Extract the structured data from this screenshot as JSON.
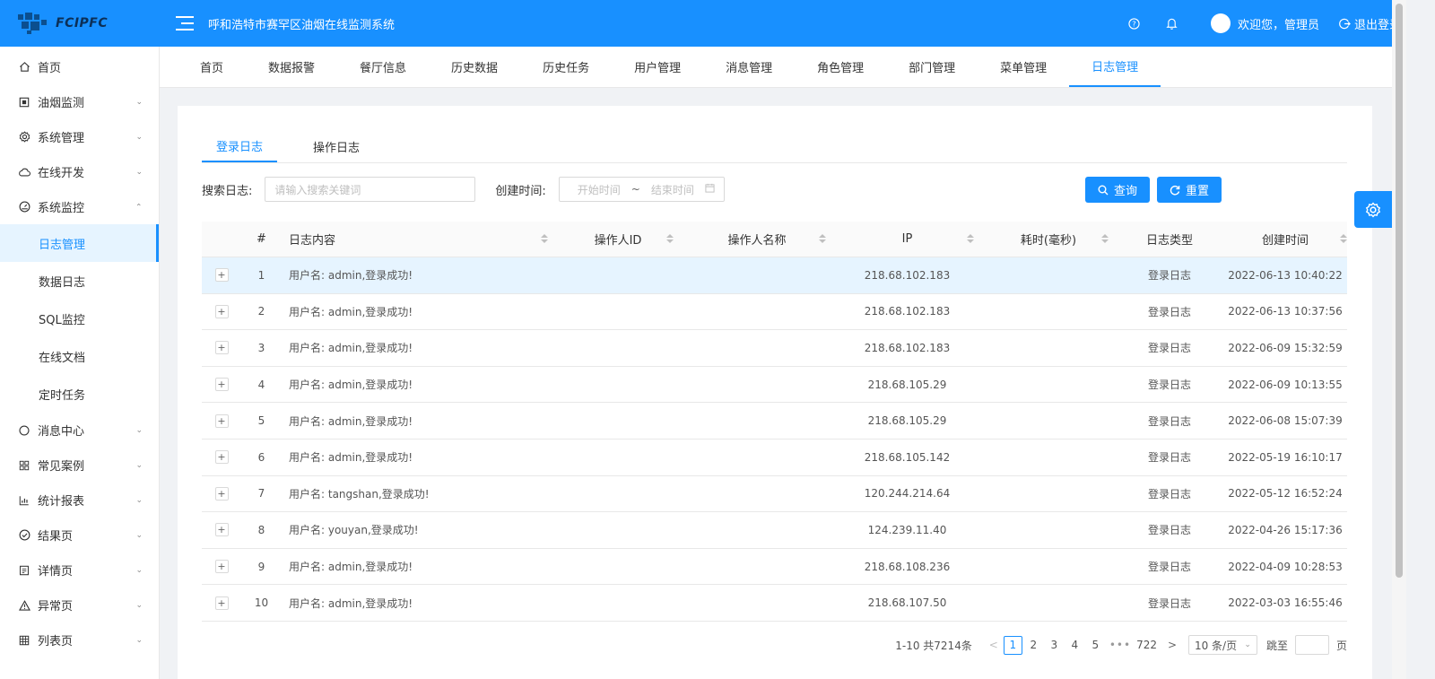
{
  "header": {
    "logo_text": "FCIPFC",
    "title": "呼和浩特市赛罕区油烟在线监测系统",
    "welcome": "欢迎您，管理员",
    "logout": "退出登录",
    "help_icon": "help-icon",
    "bell_icon": "bell-icon"
  },
  "sidebar": {
    "items": [
      {
        "label": "首页",
        "icon": "home-icon"
      },
      {
        "label": "油烟监测",
        "icon": "monitor-icon"
      },
      {
        "label": "系统管理",
        "icon": "gear-icon"
      },
      {
        "label": "在线开发",
        "icon": "cloud-icon"
      },
      {
        "label": "系统监控",
        "icon": "dashboard-icon"
      }
    ],
    "sub_items": [
      {
        "label": "日志管理"
      },
      {
        "label": "数据日志"
      },
      {
        "label": "SQL监控"
      },
      {
        "label": "在线文档"
      },
      {
        "label": "定时任务"
      }
    ],
    "items_after": [
      {
        "label": "消息中心",
        "icon": "circle-icon"
      },
      {
        "label": "常见案例",
        "icon": "grid-icon"
      },
      {
        "label": "统计报表",
        "icon": "bar-chart-icon"
      },
      {
        "label": "结果页",
        "icon": "check-circle-icon"
      },
      {
        "label": "详情页",
        "icon": "profile-icon"
      },
      {
        "label": "异常页",
        "icon": "warning-icon"
      },
      {
        "label": "列表页",
        "icon": "table-icon"
      }
    ]
  },
  "topnav": {
    "tabs": [
      "首页",
      "数据报警",
      "餐厅信息",
      "历史数据",
      "历史任务",
      "用户管理",
      "消息管理",
      "角色管理",
      "部门管理",
      "菜单管理",
      "日志管理"
    ],
    "active": "日志管理"
  },
  "log_tabs": {
    "login": "登录日志",
    "operation": "操作日志"
  },
  "filters": {
    "search_label": "搜索日志:",
    "search_placeholder": "请输入搜索关键词",
    "time_label": "创建时间:",
    "start_placeholder": "开始时间",
    "range_sep": "~",
    "end_placeholder": "结束时间",
    "search_button": "查询",
    "reset_button": "重置"
  },
  "table": {
    "columns": {
      "index": "#",
      "content": "日志内容",
      "op_id": "操作人ID",
      "op_name": "操作人名称",
      "ip": "IP",
      "cost": "耗时(毫秒)",
      "type": "日志类型",
      "time": "创建时间"
    },
    "rows": [
      {
        "index": "1",
        "content": "用户名: admin,登录成功!",
        "op_id": "",
        "op_name": "",
        "ip": "218.68.102.183",
        "cost": "",
        "type": "登录日志",
        "time": "2022-06-13 10:40:22"
      },
      {
        "index": "2",
        "content": "用户名: admin,登录成功!",
        "op_id": "",
        "op_name": "",
        "ip": "218.68.102.183",
        "cost": "",
        "type": "登录日志",
        "time": "2022-06-13 10:37:56"
      },
      {
        "index": "3",
        "content": "用户名: admin,登录成功!",
        "op_id": "",
        "op_name": "",
        "ip": "218.68.102.183",
        "cost": "",
        "type": "登录日志",
        "time": "2022-06-09 15:32:59"
      },
      {
        "index": "4",
        "content": "用户名: admin,登录成功!",
        "op_id": "",
        "op_name": "",
        "ip": "218.68.105.29",
        "cost": "",
        "type": "登录日志",
        "time": "2022-06-09 10:13:55"
      },
      {
        "index": "5",
        "content": "用户名: admin,登录成功!",
        "op_id": "",
        "op_name": "",
        "ip": "218.68.105.29",
        "cost": "",
        "type": "登录日志",
        "time": "2022-06-08 15:07:39"
      },
      {
        "index": "6",
        "content": "用户名: admin,登录成功!",
        "op_id": "",
        "op_name": "",
        "ip": "218.68.105.142",
        "cost": "",
        "type": "登录日志",
        "time": "2022-05-19 16:10:17"
      },
      {
        "index": "7",
        "content": "用户名: tangshan,登录成功!",
        "op_id": "",
        "op_name": "",
        "ip": "120.244.214.64",
        "cost": "",
        "type": "登录日志",
        "time": "2022-05-12 16:52:24"
      },
      {
        "index": "8",
        "content": "用户名: youyan,登录成功!",
        "op_id": "",
        "op_name": "",
        "ip": "124.239.11.40",
        "cost": "",
        "type": "登录日志",
        "time": "2022-04-26 15:17:36"
      },
      {
        "index": "9",
        "content": "用户名: admin,登录成功!",
        "op_id": "",
        "op_name": "",
        "ip": "218.68.108.236",
        "cost": "",
        "type": "登录日志",
        "time": "2022-04-09 10:28:53"
      },
      {
        "index": "10",
        "content": "用户名: admin,登录成功!",
        "op_id": "",
        "op_name": "",
        "ip": "218.68.107.50",
        "cost": "",
        "type": "登录日志",
        "time": "2022-03-03 16:55:46"
      }
    ],
    "expand_symbol": "+"
  },
  "pagination": {
    "total_text": "1-10 共7214条",
    "prev": "<",
    "pages": [
      "1",
      "2",
      "3",
      "4",
      "5"
    ],
    "dots": "•••",
    "last_page": "722",
    "next": ">",
    "page_size": "10 条/页",
    "jump_label": "跳至",
    "page_suffix": "页"
  },
  "colors": {
    "primary": "#1890ff",
    "row_highlight": "#e6f4ff"
  }
}
